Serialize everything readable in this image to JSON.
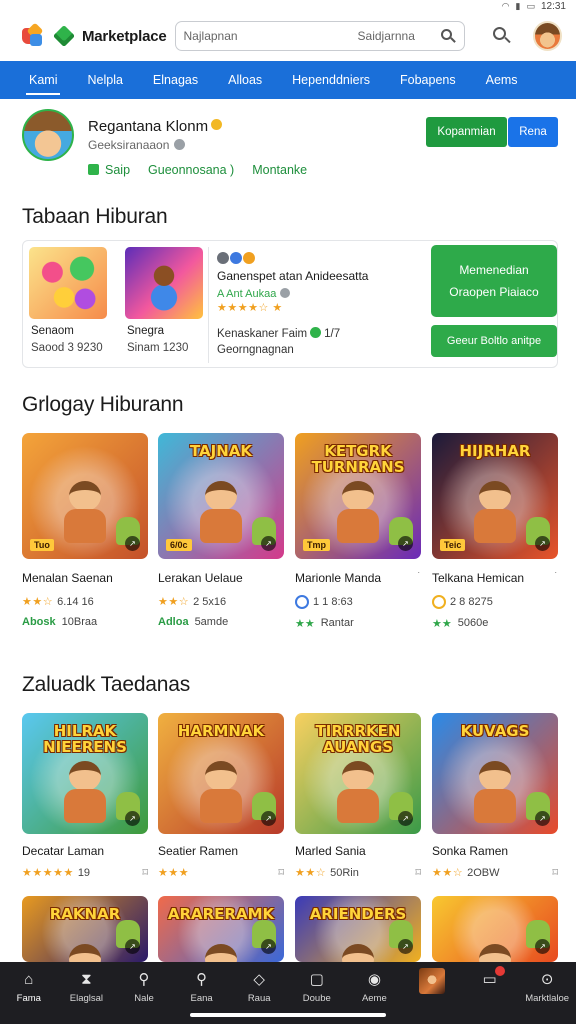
{
  "status_bar": {
    "time": "12:31"
  },
  "header": {
    "title": "Marketplace",
    "search_left": "Najlapnan",
    "search_right": "Saidjarnna",
    "search_icon": "search-icon",
    "avatar_icon": "user-avatar"
  },
  "nav_tabs": [
    "Kami",
    "Nelpla",
    "Elnagas",
    "Alloas",
    "Hependdniers",
    "Fobapens",
    "Aems"
  ],
  "profile": {
    "name": "Regantana Klonm",
    "subtitle": "Geeksiranaaon",
    "link1": "Saip",
    "link2": "Gueonnosana )",
    "link3": "Montanke",
    "btn_primary": "Kopanmian",
    "btn_secondary": "Rena"
  },
  "featured": {
    "section_title": "Tabaan Hiburan",
    "items": [
      {
        "name": "Senaom",
        "price": "Saood 3 9230"
      },
      {
        "name": "Snegra",
        "price": "Sinam 1230"
      }
    ],
    "title": "Ganenspet atan Anideesatta",
    "meta": "A Ant Aukaa",
    "stars": "★★★★☆ ★",
    "desc": "Kenaskaner Faim",
    "desc_tail": "1/7",
    "desc2": "Georngnagnan",
    "btn_big_line1": "Memenedian",
    "btn_big_line2": "Oraopen Piaiaco",
    "btn_small": "Geeur Boltlo anitpe"
  },
  "popular": {
    "section_title": "Grlogay Hiburann",
    "cards": [
      {
        "banner": "",
        "name": "Menalan Saenan",
        "stars": "★★☆",
        "rating": "6.14 16",
        "badge": "Abosk",
        "sub": "10Braa",
        "tag": "Tuo",
        "color1": "#f4a43a",
        "color2": "#c4512a"
      },
      {
        "banner": "TAJNAK",
        "name": "Lerakan Uelaue",
        "stars": "★★☆",
        "rating": "2 5x16",
        "badge": "Adloa",
        "sub": "5amde",
        "tag": "6/0c",
        "color1": "#3fb8d8",
        "color2": "#d43a8a"
      },
      {
        "banner": "KETGRK TURNRANS",
        "name": "Marionle Manda",
        "stars": "★★☆",
        "rating": "1 1 8:63",
        "badge": "★★",
        "sub": "Rantar",
        "tag": "Tmp",
        "color1": "#f0a020",
        "color2": "#6a2ab8"
      },
      {
        "banner": "HIJRHAR",
        "name": "Telkana Hemican",
        "stars": "★★☆",
        "rating": "2 8 8275",
        "badge": "★★",
        "sub": "5060e",
        "tag": "Teic",
        "color1": "#1a1a3a",
        "color2": "#e8542a"
      }
    ]
  },
  "latest": {
    "section_title": "Zaluadk Taedanas",
    "cards": [
      {
        "banner": "HILRAK NIEERENS",
        "name": "Decatar Laman",
        "stars": "★★★★★",
        "rating": "19",
        "color1": "#5ac8f0",
        "color2": "#3f9a3a"
      },
      {
        "banner": "HARMNAK",
        "name": "Seatier Ramen",
        "stars": "★★★",
        "rating": "",
        "color1": "#f0b040",
        "color2": "#b83a2a"
      },
      {
        "banner": "TIRRRKEN AUANGS",
        "name": "Marled Sania",
        "stars": "★★☆",
        "rating": "50Rin",
        "color1": "#f8d060",
        "color2": "#3a9a48"
      },
      {
        "banner": "KUVAGS",
        "name": "Sonka Ramen",
        "stars": "★★☆",
        "rating": "2OBW",
        "color1": "#2a8ae8",
        "color2": "#e84a2a"
      }
    ],
    "row2": [
      {
        "banner": "RAKNAR",
        "color1": "#e89a20",
        "color2": "#2a1a6a"
      },
      {
        "banner": "ARARERAMK",
        "color1": "#f06a4a",
        "color2": "#3a68d8"
      },
      {
        "banner": "ARIENDERS",
        "color1": "#3a3ab8",
        "color2": "#f0b020"
      },
      {
        "banner": "",
        "color1": "#f8c830",
        "color2": "#e84a20"
      }
    ]
  },
  "bottom_nav": [
    {
      "label": "Fama",
      "icon": "home-icon",
      "glyph": "⌂"
    },
    {
      "label": "Elaglsal",
      "icon": "hourglass-icon",
      "glyph": "⧗"
    },
    {
      "label": "Nale",
      "icon": "search-icon",
      "glyph": "⚲"
    },
    {
      "label": "Eana",
      "icon": "search-alt-icon",
      "glyph": "⚲"
    },
    {
      "label": "Raua",
      "icon": "diamond-icon",
      "glyph": "◇"
    },
    {
      "label": "Doube",
      "icon": "square-icon",
      "glyph": "▢"
    },
    {
      "label": "Aeme",
      "icon": "target-icon",
      "glyph": "◉"
    },
    {
      "label": "",
      "icon": "game-thumbnail",
      "glyph": ""
    },
    {
      "label": "",
      "icon": "inbox-icon",
      "glyph": "▭"
    },
    {
      "label": "Marktlaloe",
      "icon": "compass-icon",
      "glyph": "⊙"
    }
  ]
}
